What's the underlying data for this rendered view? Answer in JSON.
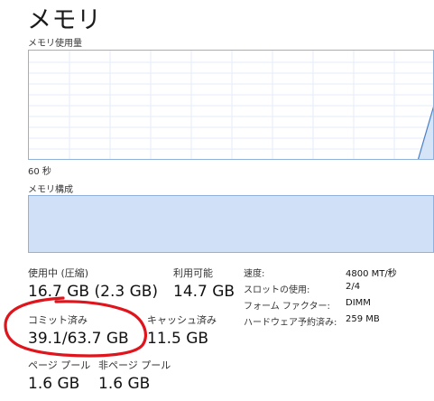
{
  "header": {
    "title": "メモリ"
  },
  "usage_graph": {
    "label": "メモリ使用量",
    "time_label": "60 秒",
    "line_color": "#4a7fc8",
    "grid_color": "#e6eef8"
  },
  "composition": {
    "label": "メモリ構成",
    "fill_color": "#cfe0f7"
  },
  "stats": {
    "in_use_label": "使用中 (圧縮)",
    "in_use_value": "16.7 GB (2.3 GB)",
    "available_label": "利用可能",
    "available_value": "14.7 GB",
    "committed_label": "コミット済み",
    "committed_value": "39.1/63.7 GB",
    "cached_label": "キャッシュ済み",
    "cached_value": "11.5 GB",
    "paged_pool_label": "ページ プール",
    "paged_pool_value": "1.6 GB",
    "nonpaged_pool_label": "非ページ プール",
    "nonpaged_pool_value": "1.6 GB"
  },
  "info": {
    "speed_label": "速度:",
    "speed_value": "4800 MT/秒",
    "slots_label": "スロットの使用:",
    "slots_value": "2/4",
    "form_factor_label": "フォーム ファクター:",
    "form_factor_value": "DIMM",
    "hw_reserved_label": "ハードウェア予約済み:",
    "hw_reserved_value": "259 MB"
  },
  "annotation": {
    "color": "#e0141c"
  }
}
